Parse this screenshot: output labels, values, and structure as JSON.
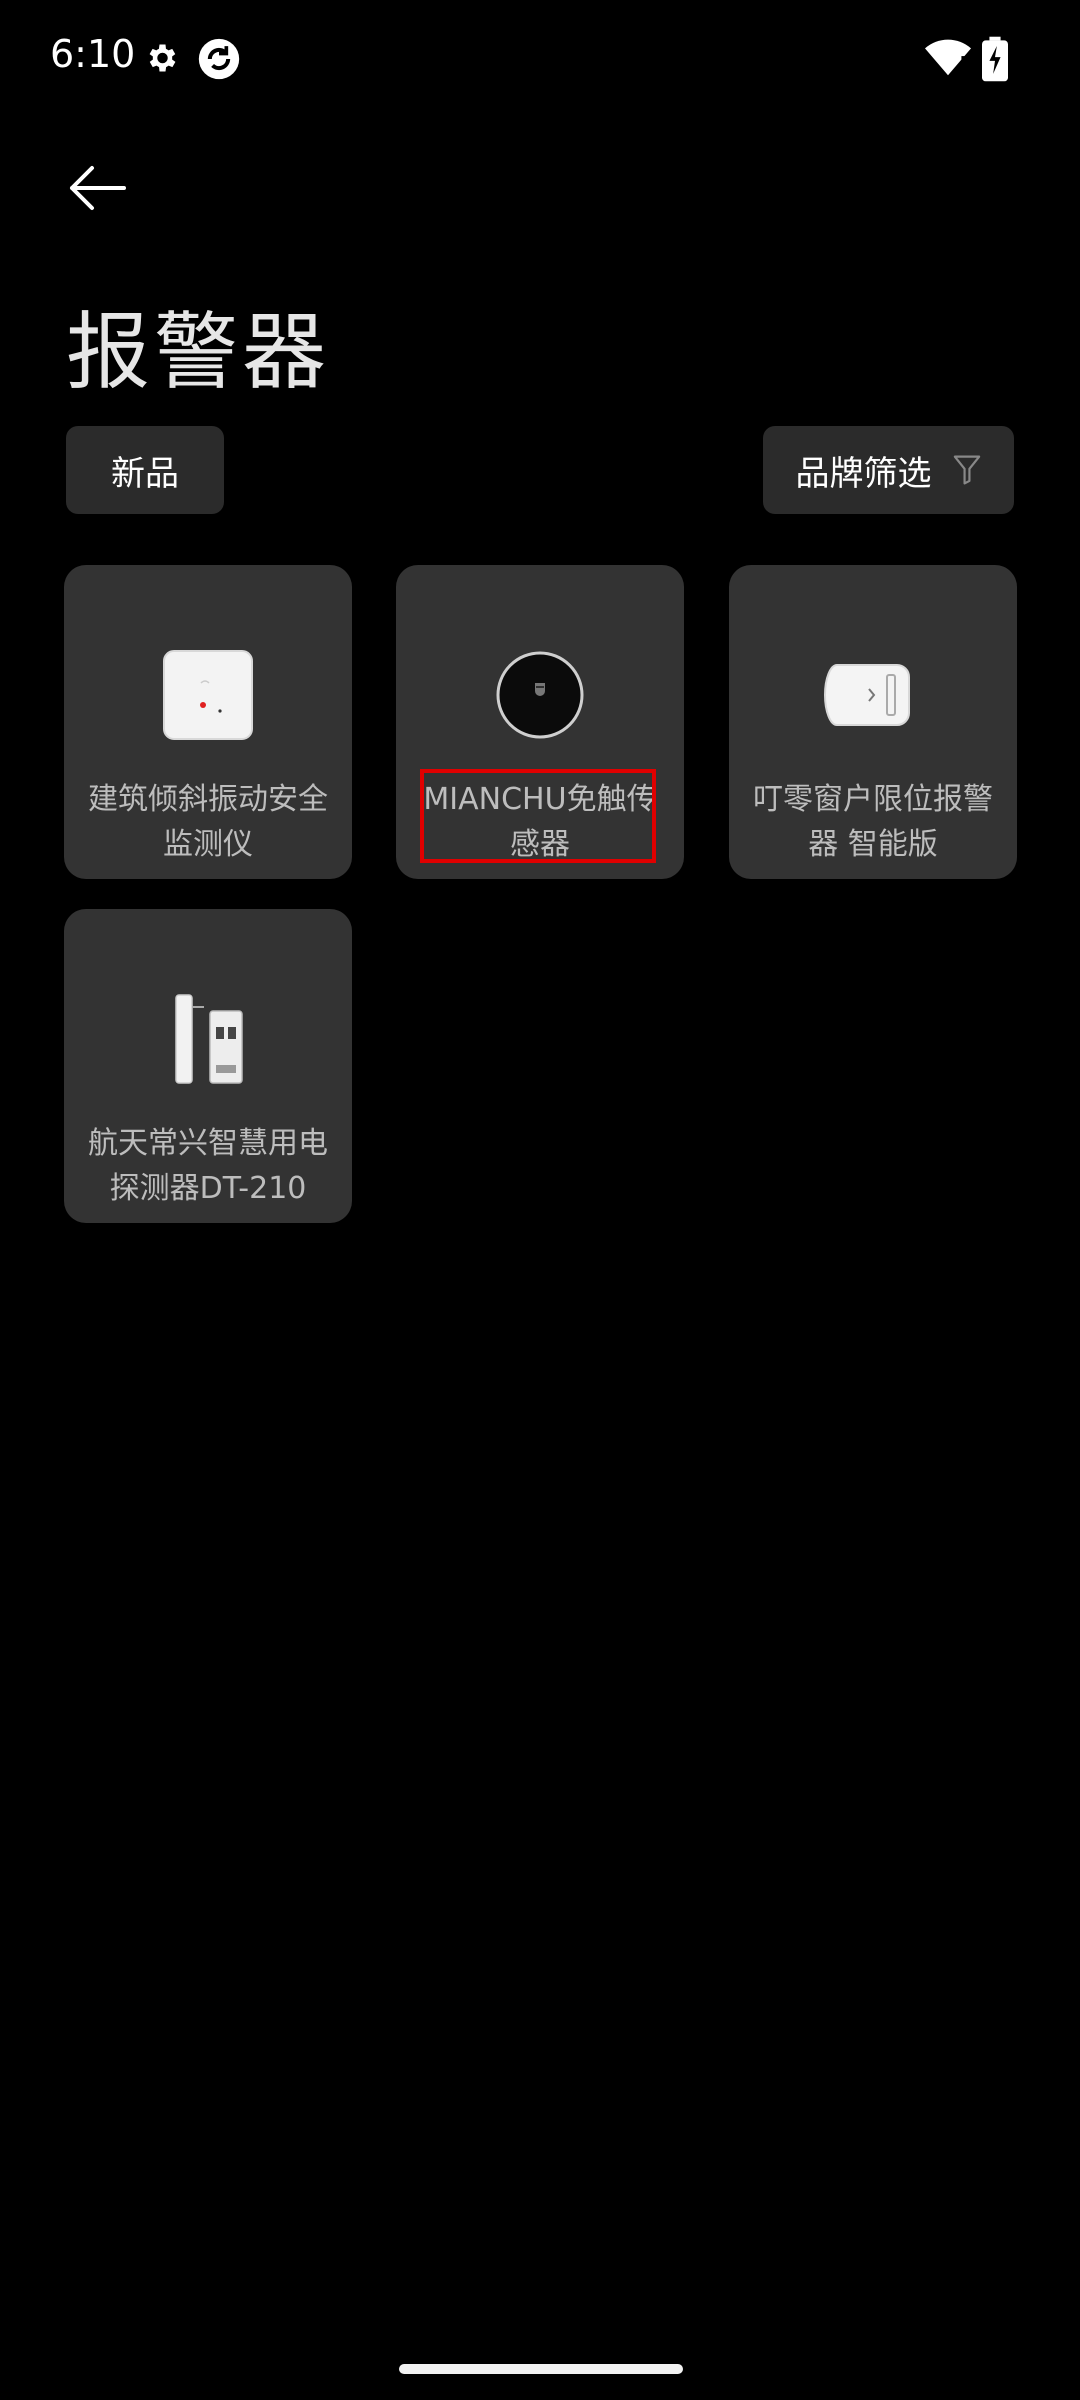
{
  "status": {
    "time": "6:10"
  },
  "page": {
    "title": "报警器"
  },
  "filters": {
    "new_label": "新品",
    "brand_label": "品牌筛选"
  },
  "products": [
    {
      "name": "建筑倾斜振动安全监测仪"
    },
    {
      "name": "MIANCHU免触传感器"
    },
    {
      "name": "叮零窗户限位报警器 智能版"
    },
    {
      "name": "航天常兴智慧用电探测器DT-210"
    }
  ],
  "colors": {
    "background": "#000000",
    "card": "#333333",
    "chip": "#2b2b2b",
    "highlight": "#e00000"
  },
  "icons": [
    "gear-icon",
    "sync-icon",
    "wifi-icon",
    "battery-icon",
    "back-arrow-icon",
    "filter-icon"
  ]
}
